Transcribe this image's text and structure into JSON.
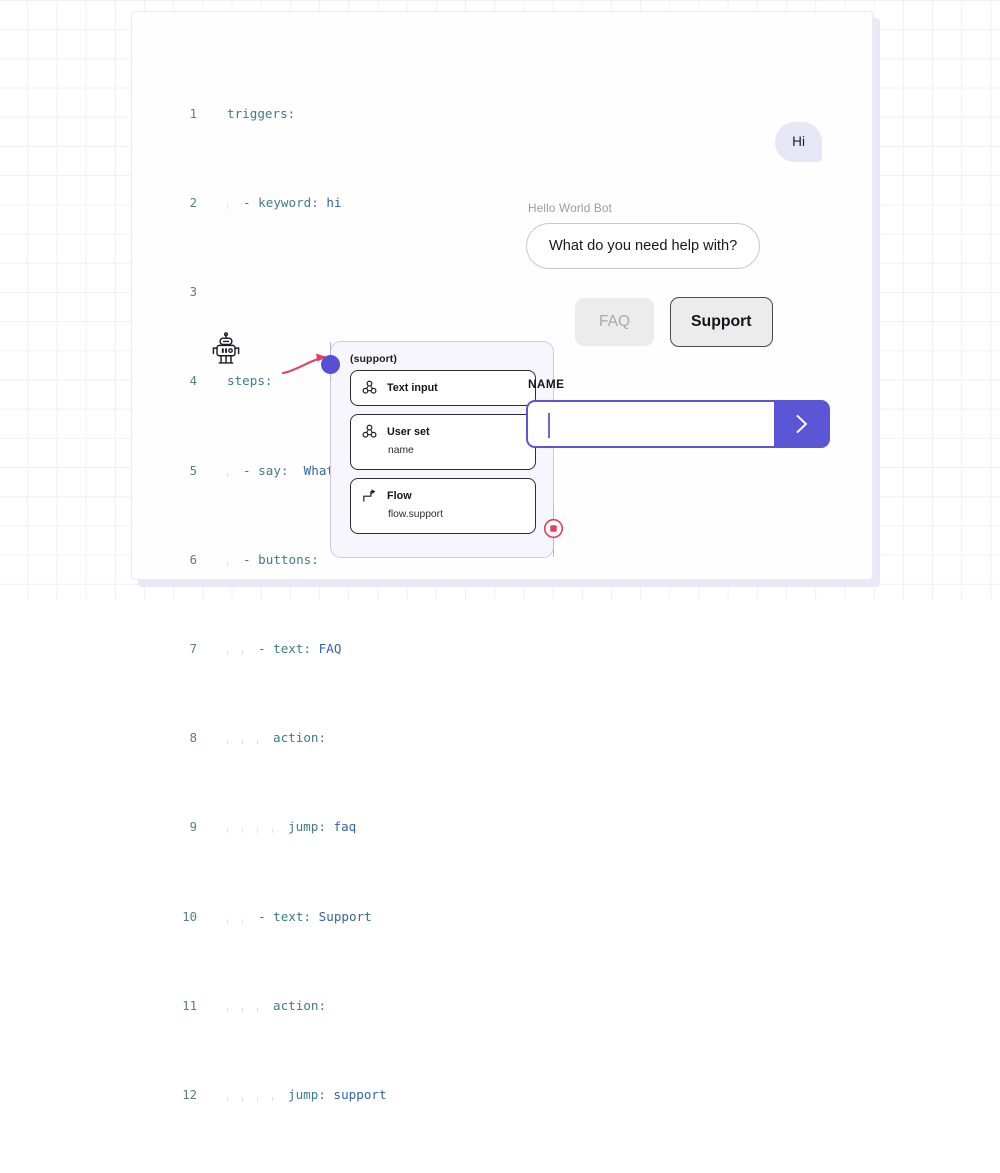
{
  "background": {
    "grid_color": "#f1f1f4",
    "panel_shadow": "#e9e8f4"
  },
  "code_editor": {
    "name": "yaml-bot-definition",
    "language": "yaml",
    "key_color": "#3f7c84",
    "value_color": "#3464a8",
    "lines": [
      {
        "no": "1",
        "indent": 0,
        "text": "triggers:",
        "key": "triggers:",
        "value": ""
      },
      {
        "no": "2",
        "indent": 1,
        "text": "- keyword: hi",
        "key": "- keyword:",
        "value": "hi"
      },
      {
        "no": "3",
        "indent": 1,
        "text": "",
        "key": "",
        "value": ""
      },
      {
        "no": "4",
        "indent": 0,
        "text": "steps:",
        "key": "steps:",
        "value": ""
      },
      {
        "no": "5",
        "indent": 1,
        "text": "- say:  What do you need help with?",
        "key": "- say:",
        "value": "What do you need help with?"
      },
      {
        "no": "6",
        "indent": 1,
        "text": "- buttons:",
        "key": "- buttons:",
        "value": ""
      },
      {
        "no": "7",
        "indent": 2,
        "text": "- text: FAQ",
        "key": "- text:",
        "value": "FAQ"
      },
      {
        "no": "8",
        "indent": 3,
        "text": "action:",
        "key": "action:",
        "value": ""
      },
      {
        "no": "9",
        "indent": 4,
        "text": "jump: faq",
        "key": "jump:",
        "value": "faq"
      },
      {
        "no": "10",
        "indent": 2,
        "text": "- text: Support",
        "key": "- text:",
        "value": "Support"
      },
      {
        "no": "11",
        "indent": 3,
        "text": "action:",
        "key": "action:",
        "value": ""
      },
      {
        "no": "12",
        "indent": 4,
        "text": "jump: support",
        "key": "jump:",
        "value": "support"
      }
    ]
  },
  "flow_diagram": {
    "title": "(support)",
    "entry_dot_color": "#5650d3",
    "card_bg": "#f7f6fd",
    "card_border": "#cdc8ee",
    "incoming_arrow_color": "#e2415c",
    "stop_color": "#e2415c",
    "nodes": [
      {
        "icon": "molecule-icon",
        "label": "Text input",
        "sub": ""
      },
      {
        "icon": "molecule-icon",
        "label": "User set",
        "sub": "name"
      },
      {
        "icon": "flow-step-icon",
        "label": "Flow",
        "sub": "flow.support"
      }
    ]
  },
  "chat_preview": {
    "user_message": "Hi",
    "user_bubble_color": "#e6e6f4",
    "bot_name": "Hello World Bot",
    "bot_message": "What do you need help with?",
    "buttons": [
      {
        "label": "FAQ",
        "state": "disabled"
      },
      {
        "label": "Support",
        "state": "selected"
      }
    ],
    "input_label": "NAME",
    "input_value": "",
    "input_placeholder": "",
    "accent_color": "#5b56d6",
    "send_icon": "chevron-right-icon",
    "avatar_icon": "robot-icon"
  }
}
